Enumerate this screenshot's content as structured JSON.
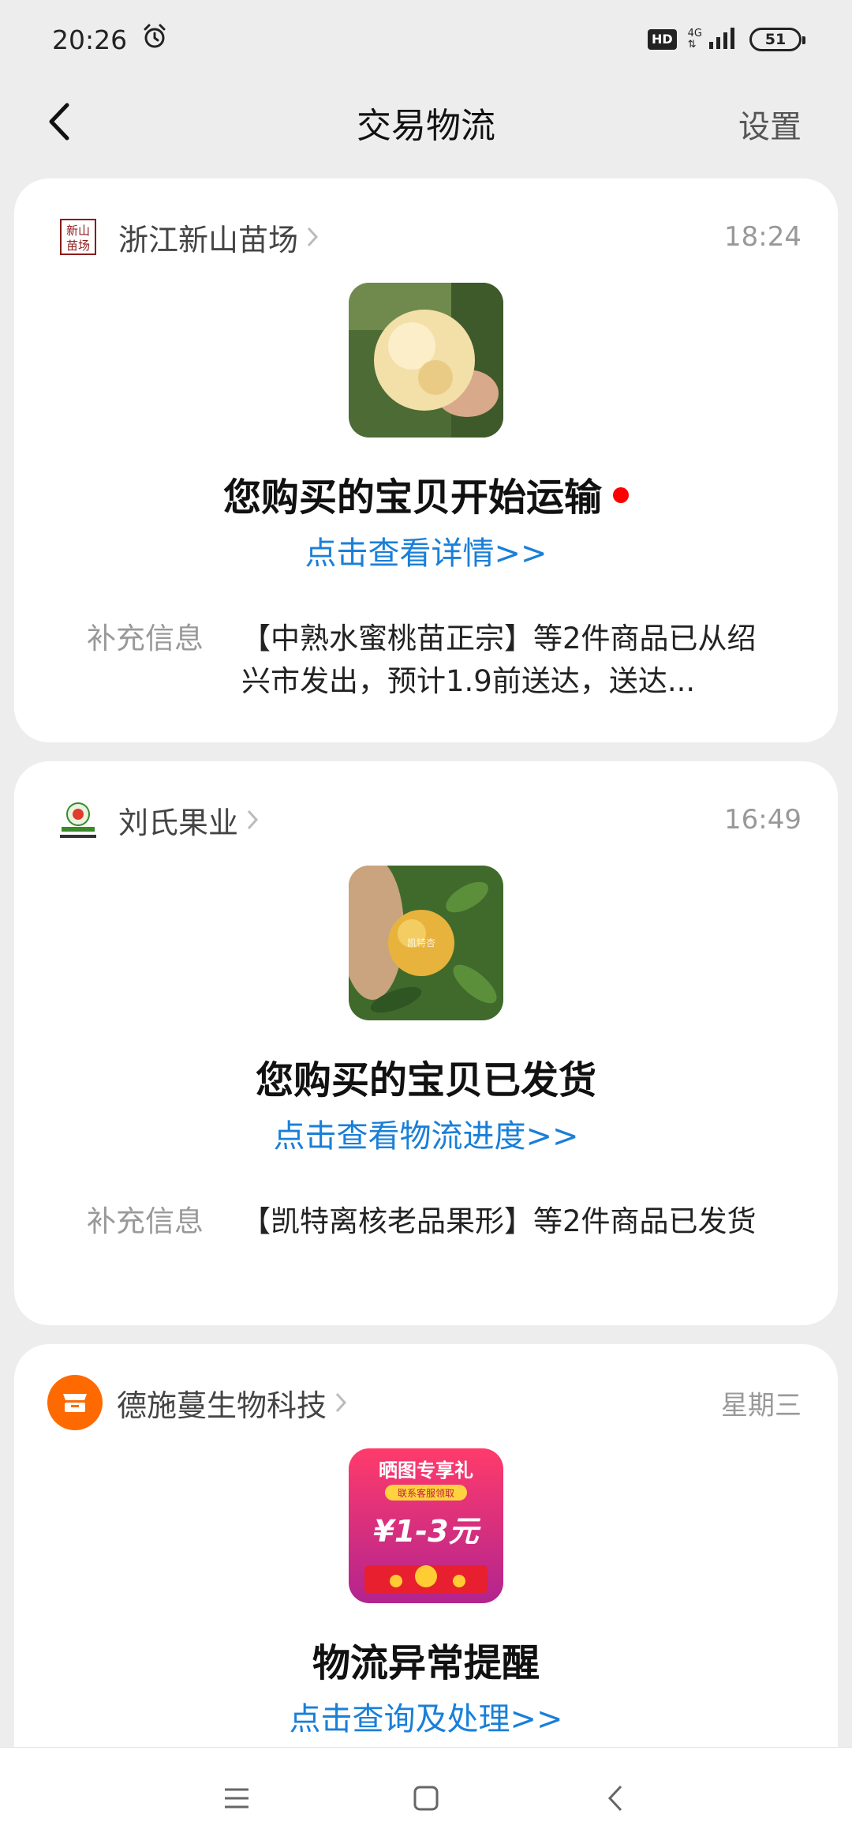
{
  "status_bar": {
    "time": "20:26",
    "alarm_icon": "alarm-clock-icon",
    "hd": "HD",
    "network": "4G",
    "battery": "51"
  },
  "header": {
    "title": "交易物流",
    "settings": "设置",
    "back_icon": "chevron-left-icon"
  },
  "messages": [
    {
      "shop": "浙江新山苗场",
      "logo_text": "新山苗场",
      "time": "18:24",
      "title": "您购买的宝贝开始运输",
      "unread": true,
      "link": "点击查看详情>>",
      "info_label": "补充信息",
      "info_text": "【中熟水蜜桃苗正宗】等2件商品已从绍兴市发出，预计1.9前送达，送达..."
    },
    {
      "shop": "刘氏果业",
      "time": "16:49",
      "title": "您购买的宝贝已发货",
      "unread": false,
      "link": "点击查看物流进度>>",
      "thumb_text": "凯特杏",
      "info_label": "补充信息",
      "info_text": "【凯特离核老品果形】等2件商品已发货"
    },
    {
      "shop": "德施蔓生物科技",
      "time": "星期三",
      "title": "物流异常提醒",
      "link": "点击查询及处理>>",
      "promo": {
        "line1": "晒图专享礼",
        "line2": "联系客服领取",
        "amount": "¥1-3元"
      }
    }
  ],
  "nav_bar": {
    "menu_icon": "menu-icon",
    "home_icon": "home-square-icon",
    "back_icon": "back-triangle-icon"
  },
  "colors": {
    "link": "#1a7fd8",
    "unread_dot": "#ff0000",
    "background": "#ededed",
    "brand_orange": "#ff6a00"
  }
}
